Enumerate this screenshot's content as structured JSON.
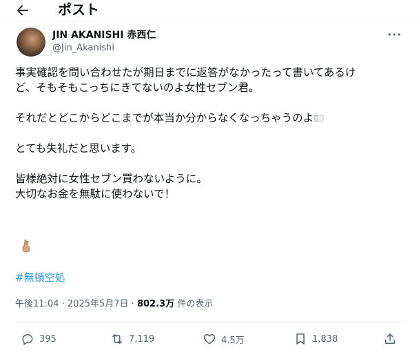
{
  "header": {
    "title": "ポスト"
  },
  "author": {
    "display_name": "JIN AKANISHI 赤西仁",
    "handle": "@Jin_Akanishi"
  },
  "tweet": {
    "paragraph1_line1": "事実確認を問い合わせたが期日までに返答がなかったって書いてあるけ",
    "paragraph1_line2": "ど、そもそもこっちにきてないのよ女性セブン君。",
    "paragraph2": "それだとどこからどこまでが本当か分からなくなっちゃうのよ",
    "paragraph3": "とても失礼だと思います。",
    "paragraph4_line1": "皆様絶対に女性セブン買わないように。",
    "paragraph4_line2": "大切なお金を無駄に使わないで！",
    "hashtag": "#無頓空処"
  },
  "meta": {
    "time": "午後11:04",
    "separator": "·",
    "date": "2025年5月7日",
    "views_count": "802.3万",
    "views_label": "件の表示"
  },
  "actions": {
    "replies": "395",
    "reposts": "7,119",
    "likes": "4.5万",
    "bookmarks": "1,838"
  },
  "icons": {
    "back": "back-arrow-icon",
    "more": "more-dots-icon",
    "reply": "reply-icon",
    "repost": "repost-icon",
    "like": "heart-icon",
    "bookmark": "bookmark-icon",
    "share": "share-icon",
    "paper_emoji": "roll-of-paper-icon",
    "gesture_emoji": "crossed-fingers-icon"
  },
  "colors": {
    "accent": "#1d9bf0",
    "text_primary": "#0f1419",
    "text_secondary": "#536471"
  }
}
